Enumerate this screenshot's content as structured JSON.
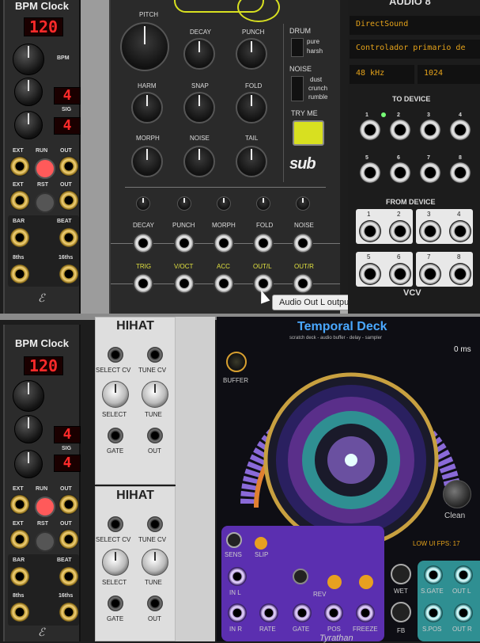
{
  "bpm_top": {
    "title": "BPM Clock",
    "bpm_value": "120",
    "bpm_label": "BPM",
    "sig_top": "4",
    "sig_bottom": "4",
    "sig_label": "SIG",
    "ext": "EXT",
    "run": "RUN",
    "out": "OUT",
    "ext2": "EXT",
    "rst": "RST",
    "out2": "OUT",
    "bar": "BAR",
    "beat": "BEAT",
    "eighths": "8ths",
    "sixteenths": "16ths"
  },
  "bpm_bottom": {
    "title": "BPM Clock",
    "bpm_value": "120",
    "sig_top": "4",
    "sig_bottom": "4",
    "sig_label": "SIG",
    "ext": "EXT",
    "run": "RUN",
    "out": "OUT",
    "ext2": "EXT",
    "rst": "RST",
    "out2": "OUT",
    "bar": "BAR",
    "beat": "BEAT",
    "eighths": "8ths",
    "sixteenths": "16ths"
  },
  "impact": {
    "pitch": "PITCH",
    "decay": "DECAY",
    "punch": "PUNCH",
    "harm": "HARM",
    "snap": "SNAP",
    "fold": "FOLD",
    "morph": "MORPH",
    "noise": "NOISE",
    "tail": "TAIL",
    "drum": "DRUM",
    "pure": "pure",
    "harsh": "harsh",
    "noise_sw": "NOISE",
    "dust": "dust",
    "crunch": "crunch",
    "rumble": "rumble",
    "tryme": "TRY ME",
    "cv_labels": [
      "DECAY",
      "PUNCH",
      "MORPH",
      "FOLD",
      "NOISE"
    ],
    "io_labels": [
      "TRIG",
      "V/OCT",
      "ACC",
      "OUT/L",
      "OUT/R"
    ]
  },
  "tooltip": "Audio Out L output",
  "audio": {
    "title": "AUDIO 8",
    "driver": "DirectSound",
    "device": "Controlador primario de",
    "sample_rate": "48 kHz",
    "block_size": "1024",
    "to_device": "TO DEVICE",
    "from_device": "FROM DEVICE",
    "to_nums": [
      "1",
      "2",
      "3",
      "4",
      "5",
      "6",
      "7",
      "8"
    ],
    "from_nums": [
      "1",
      "2",
      "3",
      "4",
      "5",
      "6",
      "7",
      "8"
    ],
    "brand": "VCV"
  },
  "hihat_top": {
    "title": "HIHAT",
    "select_cv": "SELECT CV",
    "tune_cv": "TUNE CV",
    "select": "SELECT",
    "tune": "TUNE",
    "gate": "GATE",
    "out": "OUT"
  },
  "hihat_bottom": {
    "title": "HIHAT",
    "select_cv": "SELECT CV",
    "tune_cv": "TUNE CV",
    "select": "SELECT",
    "tune": "TUNE",
    "gate": "GATE",
    "out": "OUT"
  },
  "deck": {
    "title": "Temporal Deck",
    "subtitle": "scratch deck - audio buffer - delay - sampler",
    "time": "0 ms",
    "buffer": "BUFFER",
    "clean": "Clean",
    "fps": "LOW UI FPS: 17",
    "sens": "SENS",
    "slip": "SLIP",
    "rev": "REV",
    "wet": "WET",
    "fb": "FB",
    "in_l": "IN L",
    "in_r": "IN R",
    "rate": "RATE",
    "gate": "GATE",
    "pos": "POS",
    "freeze": "FREEZE",
    "sgate": "S.GATE",
    "outl": "OUT L",
    "spos": "S.POS",
    "outr": "OUT R",
    "brand": "Tyrathan"
  },
  "colors": {
    "led_red": "#ff2a2a",
    "try_me": "#d8e020",
    "deck_purple": "#5b2fb0",
    "deck_teal": "#2f8f92",
    "audio_orange": "#e4a21a"
  }
}
